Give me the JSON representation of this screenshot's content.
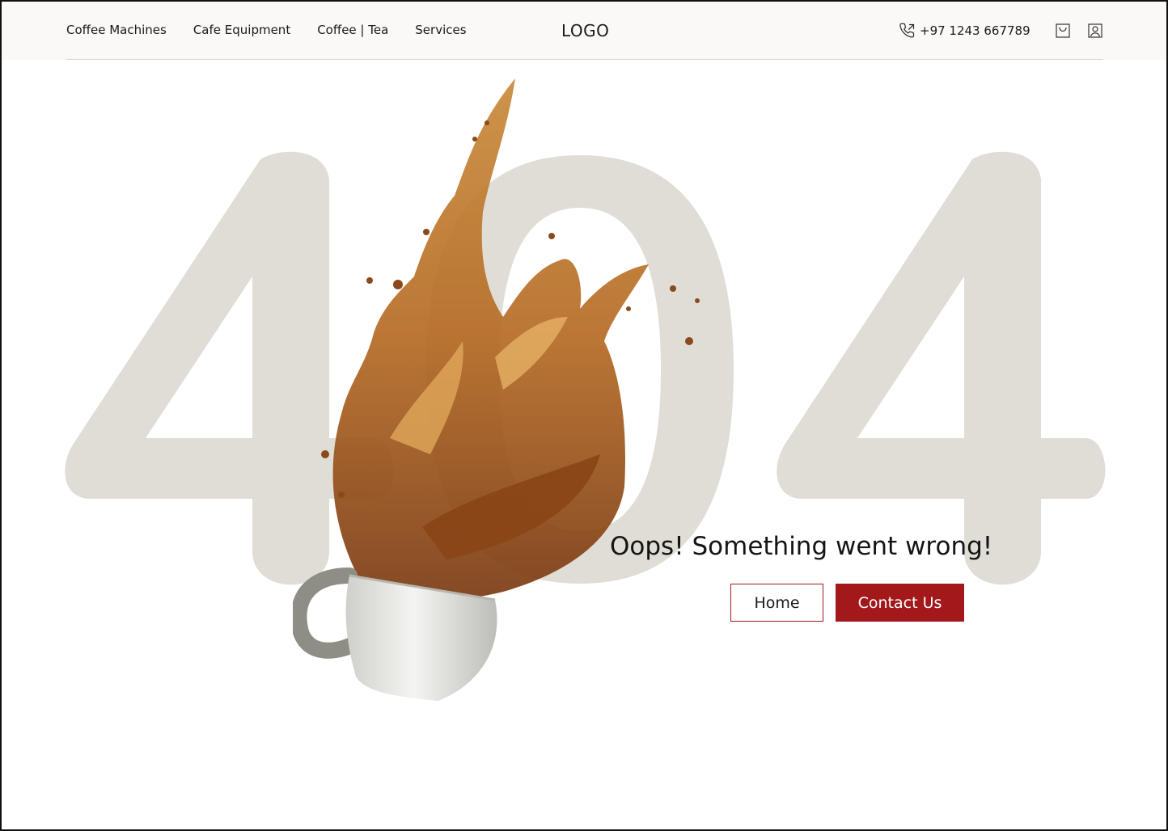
{
  "nav": {
    "items": [
      {
        "label": "Coffee Machines"
      },
      {
        "label": "Cafe Equipment"
      },
      {
        "label": "Coffee | Tea"
      },
      {
        "label": "Services"
      }
    ]
  },
  "logo": {
    "label": "LOGO"
  },
  "contact": {
    "phone": "+97 1243 667789",
    "icon": "phone-icon"
  },
  "header_icons": [
    "shopping-bag-icon",
    "user-icon"
  ],
  "hero": {
    "code": "404",
    "message": "Oops! Something went wrong!",
    "illustration": "spilled-coffee-cup"
  },
  "buttons": {
    "home_label": "Home",
    "contact_label": "Contact Us"
  },
  "colors": {
    "accent": "#a3191b",
    "big_number": "#e0ddd7",
    "header_bg": "#faf9f7"
  }
}
